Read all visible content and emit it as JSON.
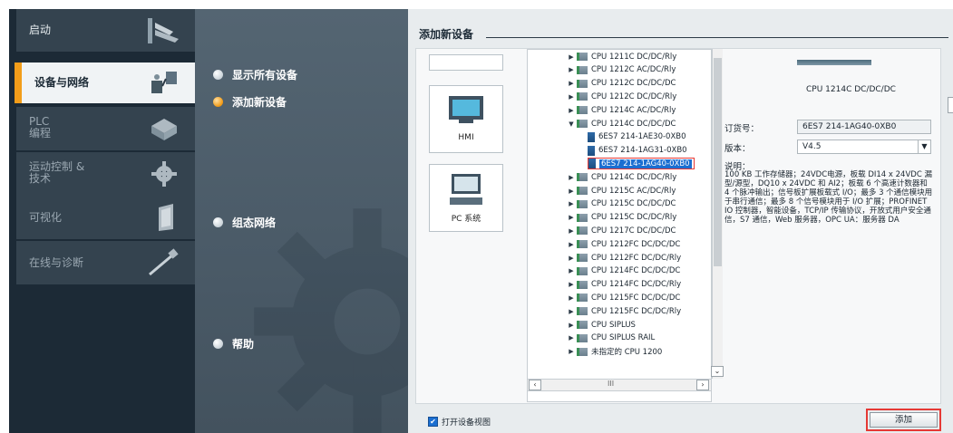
{
  "nav": {
    "items": [
      {
        "label": "启动"
      },
      {
        "label": "设备与网络"
      },
      {
        "label": "PLC\n编程"
      },
      {
        "label": "运动控制 &\n技术"
      },
      {
        "label": "可视化"
      },
      {
        "label": "在线与诊断"
      }
    ]
  },
  "middle": {
    "options": [
      {
        "label": "显示所有设备"
      },
      {
        "label": "添加新设备"
      },
      {
        "label": "组态网络"
      },
      {
        "label": "帮助"
      }
    ]
  },
  "content": {
    "title": "添加新设备",
    "devices": [
      {
        "label": ""
      },
      {
        "label": "HMI"
      },
      {
        "label": "PC 系统"
      }
    ],
    "tree": [
      {
        "label": "CPU 1211C DC/DC/Rly",
        "type": "folder"
      },
      {
        "label": "CPU 1212C AC/DC/Rly",
        "type": "folder"
      },
      {
        "label": "CPU 1212C DC/DC/DC",
        "type": "folder"
      },
      {
        "label": "CPU 1212C DC/DC/Rly",
        "type": "folder"
      },
      {
        "label": "CPU 1214C AC/DC/Rly",
        "type": "folder"
      },
      {
        "label": "CPU 1214C DC/DC/DC",
        "type": "folder-open"
      },
      {
        "label": "6ES7 214-1AE30-0XB0",
        "type": "module"
      },
      {
        "label": "6ES7 214-1AG31-0XB0",
        "type": "module"
      },
      {
        "label": "6ES7 214-1AG40-0XB0",
        "type": "module-selected"
      },
      {
        "label": "CPU 1214C DC/DC/Rly",
        "type": "folder"
      },
      {
        "label": "CPU 1215C AC/DC/Rly",
        "type": "folder"
      },
      {
        "label": "CPU 1215C DC/DC/DC",
        "type": "folder"
      },
      {
        "label": "CPU 1215C DC/DC/Rly",
        "type": "folder"
      },
      {
        "label": "CPU 1217C DC/DC/DC",
        "type": "folder"
      },
      {
        "label": "CPU 1212FC DC/DC/DC",
        "type": "folder"
      },
      {
        "label": "CPU 1212FC DC/DC/Rly",
        "type": "folder"
      },
      {
        "label": "CPU 1214FC DC/DC/DC",
        "type": "folder"
      },
      {
        "label": "CPU 1214FC DC/DC/Rly",
        "type": "folder"
      },
      {
        "label": "CPU 1215FC DC/DC/DC",
        "type": "folder"
      },
      {
        "label": "CPU 1215FC DC/DC/Rly",
        "type": "folder"
      },
      {
        "label": "CPU SIPLUS",
        "type": "folder"
      },
      {
        "label": "CPU SIPLUS RAIL",
        "type": "folder"
      },
      {
        "label": "未指定的 CPU 1200",
        "type": "folder"
      }
    ],
    "hscroll_mid": "III",
    "details": {
      "device_name": "CPU 1214C DC/DC/DC",
      "order_label": "订货号：",
      "order_value": "6ES7 214-1AG40-0XB0",
      "version_label": "版本：",
      "version_value": "V4.5",
      "description_label": "说明：",
      "description": "100 KB 工作存储器；24VDC电源，板载 DI14 x 24VDC 漏型/源型，DQ10 x 24VDC 和 AI2；板载 6 个高速计数器和 4 个脉冲输出；信号板扩展板载式 I/O；最多 3 个通信模块用于串行通信；最多 8 个信号模块用于 I/O 扩展；PROFINET IO 控制器，智能设备，TCP/IP 传输协议，开放式用户安全通信，S7 通信，Web 服务器，OPC UA：服务器 DA"
    },
    "open_device_view_label": "打开设备视图",
    "open_device_view_checked": true,
    "add_button_label": "添加"
  },
  "colors": {
    "accent": "#f29d1a",
    "selection": "#1b6fd1",
    "highlight_border": "#e53935",
    "nav_bg": "#1c2a36"
  }
}
